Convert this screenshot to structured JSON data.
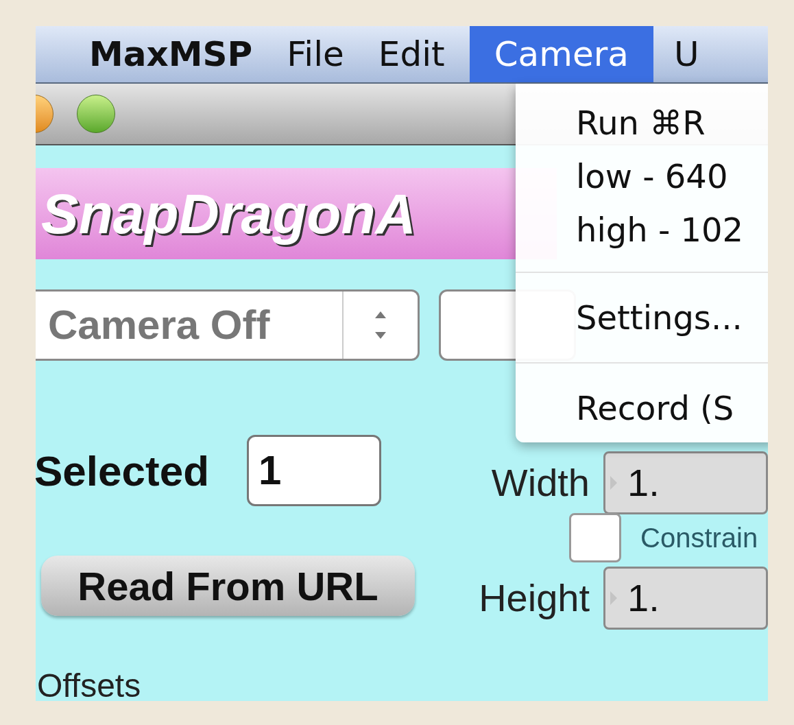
{
  "menu_bar": [
    {
      "label": "MaxMSP",
      "bold": true,
      "selected": false
    },
    {
      "label": "File",
      "bold": false,
      "selected": false
    },
    {
      "label": "Edit",
      "bold": false,
      "selected": false
    },
    {
      "label": "Camera",
      "bold": false,
      "selected": true
    },
    {
      "label": "U",
      "bold": false,
      "selected": false
    }
  ],
  "menu": {
    "groups": [
      [
        "Run ⌘R",
        "low - 640",
        "high - 102"
      ],
      [
        "Settings..."
      ],
      [
        "Record (S"
      ]
    ]
  },
  "banner": {
    "title": "SnapDragonA"
  },
  "camera_select": {
    "value": "Camera Off"
  },
  "selected": {
    "label": "Selected",
    "value": "1"
  },
  "read_button": {
    "label": "Read From URL"
  },
  "width": {
    "label": "Width",
    "value": "1."
  },
  "constrain": {
    "label": "Constrain",
    "checked": false
  },
  "height": {
    "label": "Height",
    "value": "1."
  },
  "offsets": {
    "label": "Offsets"
  }
}
